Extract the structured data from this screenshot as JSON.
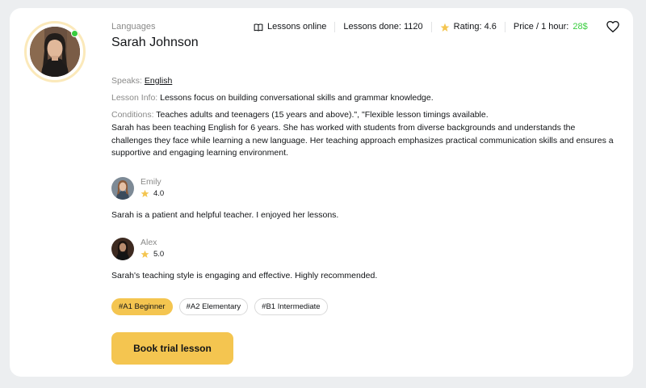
{
  "teacher": {
    "category": "Languages",
    "name": "Sarah Johnson",
    "online": true
  },
  "stats": {
    "lessons_online": "Lessons online",
    "lessons_done": "Lessons done: 1120",
    "rating": "Rating: 4.6",
    "price_label": "Price / 1 hour: ",
    "price_value": "28$"
  },
  "info": {
    "speaks_label": "Speaks: ",
    "speaks_value": "English",
    "lesson_info_label": "Lesson Info: ",
    "lesson_info_value": "Lessons focus on building conversational skills and grammar knowledge.",
    "conditions_label": "Conditions: ",
    "conditions_value": "Teaches adults and teenagers (15 years and above).\", \"Flexible lesson timings available."
  },
  "bio": "Sarah has been teaching English for 6 years. She has worked with students from diverse backgrounds and understands the challenges they face while learning a new language. Her teaching approach emphasizes practical communication skills and ensures a supportive and engaging learning environment.",
  "reviews": [
    {
      "name": "Emily",
      "rating": "4.0",
      "comment": "Sarah is a patient and helpful teacher. I enjoyed her lessons."
    },
    {
      "name": "Alex",
      "rating": "5.0",
      "comment": "Sarah's teaching style is engaging and effective. Highly recommended."
    }
  ],
  "tags": [
    "#A1 Beginner",
    "#A2 Elementary",
    "#B1 Intermediate"
  ],
  "book_button": "Book trial lesson",
  "colors": {
    "accent": "#f4c550",
    "price_green": "#38cd3e",
    "online_dot": "#38cd3e",
    "muted_text": "#8a8a89"
  },
  "icons": {
    "lessons_online": "book-open-icon",
    "rating": "star-icon",
    "favorite": "heart-icon"
  }
}
